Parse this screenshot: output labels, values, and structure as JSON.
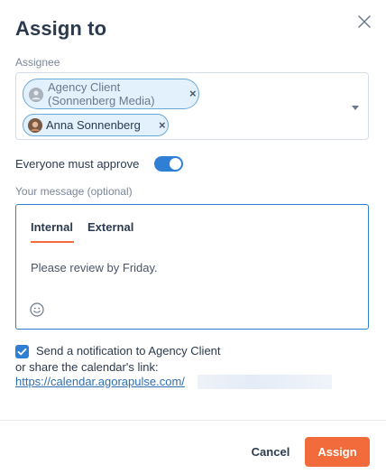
{
  "dialog": {
    "title": "Assign to",
    "close_icon": "close-icon"
  },
  "assignee": {
    "label": "Assignee",
    "chips": [
      {
        "name": "Agency Client\n(Sonnenberg Media)",
        "avatar": "user-placeholder-icon",
        "remove": "×"
      },
      {
        "name": "Anna Sonnenberg",
        "avatar": "user-avatar",
        "remove": "×"
      }
    ],
    "dropdown_icon": "chevron-down-icon"
  },
  "approval": {
    "label": "Everyone must approve",
    "enabled": true
  },
  "message": {
    "label": "Your message (optional)",
    "tabs": [
      "Internal",
      "External"
    ],
    "active_tab": "Internal",
    "text": "Please review by Friday.",
    "emoji_icon": "smiley-icon"
  },
  "notification": {
    "checked": true,
    "text": "Send a notification to Agency Client",
    "share_text": "or share the calendar's link:",
    "link": "https://calendar.agorapulse.com/"
  },
  "footer": {
    "cancel_label": "Cancel",
    "assign_label": "Assign"
  },
  "colors": {
    "accent_blue": "#2f80d5",
    "assign_orange": "#f26b3a",
    "chip_bg": "#e3f1fc"
  }
}
